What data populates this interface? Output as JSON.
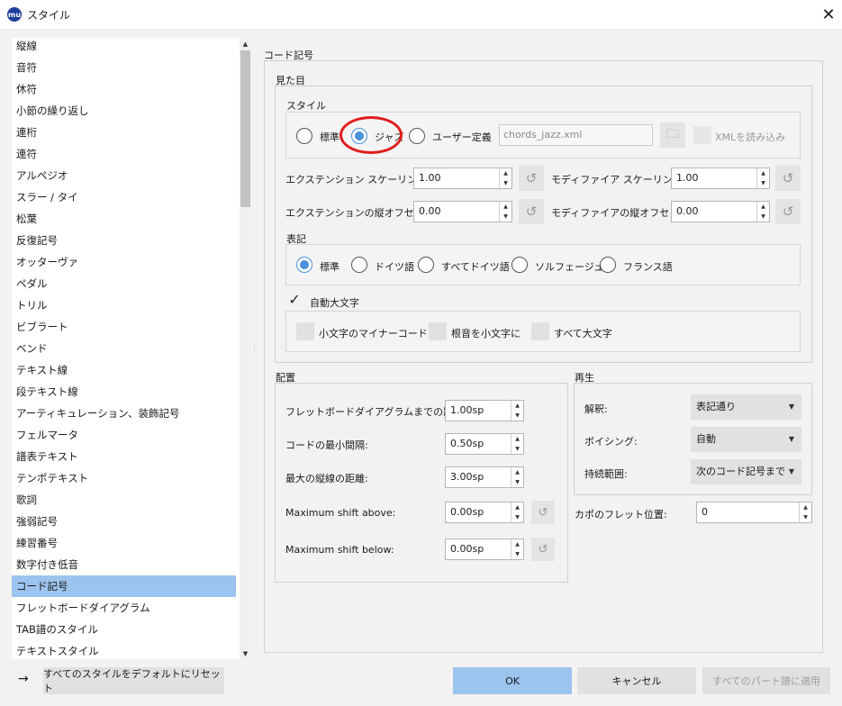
{
  "window": {
    "app_icon_text": "mu",
    "title": "スタイル",
    "close_icon": "close-icon"
  },
  "sidebar": {
    "items": [
      "縦線",
      "音符",
      "休符",
      "小節の繰り返し",
      "連桁",
      "連符",
      "アルペジオ",
      "スラー / タイ",
      "松葉",
      "反復記号",
      "オッターヴァ",
      "ペダル",
      "トリル",
      "ビブラート",
      "ベンド",
      "テキスト線",
      "段テキスト線",
      "アーティキュレーション、装飾記号",
      "フェルマータ",
      "譜表テキスト",
      "テンポテキスト",
      "歌詞",
      "強弱記号",
      "練習番号",
      "数字付き低音",
      "コード記号",
      "フレットボードダイアグラム",
      "TAB譜のスタイル",
      "テキストスタイル"
    ],
    "selected_index": 25
  },
  "page": {
    "title": "コード記号",
    "appearance": {
      "label": "見た目",
      "style_group": {
        "label": "スタイル",
        "options": [
          "標準",
          "ジャズ",
          "ユーザー定義"
        ],
        "selected": "ジャズ",
        "file_field_value": "chords_jazz.xml",
        "load_xml_label": "XMLを読み込み"
      },
      "extension_scaling": {
        "label": "エクステンション スケーリング:",
        "value": "1.00"
      },
      "modifier_scaling": {
        "label": "モディファイア スケーリング:",
        "value": "1.00"
      },
      "extension_offset": {
        "label": "エクステンションの縦オフセット:",
        "value": "0.00"
      },
      "modifier_offset": {
        "label": "モディファイアの縦オフセット:",
        "value": "0.00"
      },
      "notation": {
        "label": "表記",
        "options": [
          "標準",
          "ドイツ語",
          "すべてドイツ語",
          "ソルフェージュ",
          "フランス語"
        ],
        "selected": "標準"
      },
      "auto_capitalize": {
        "label": "自動大文字",
        "checked": true,
        "options": [
          "小文字のマイナーコード",
          "根音を小文字に",
          "すべて大文字"
        ]
      }
    },
    "placement": {
      "label": "配置",
      "rows": [
        {
          "label": "フレットボードダイアグラムまでの距離:",
          "value": "1.00sp"
        },
        {
          "label": "コードの最小間隔:",
          "value": "0.50sp"
        },
        {
          "label": "最大の縦線の距離:",
          "value": "3.00sp"
        },
        {
          "label": "Maximum shift above:",
          "value": "0.00sp"
        },
        {
          "label": "Maximum shift below:",
          "value": "0.00sp"
        }
      ]
    },
    "playback": {
      "label": "再生",
      "rows": [
        {
          "label": "解釈:",
          "value": "表記通り"
        },
        {
          "label": "ボイシング:",
          "value": "自動"
        },
        {
          "label": "持続範囲:",
          "value": "次のコード記号まで"
        }
      ]
    },
    "capo": {
      "label": "カポのフレット位置:",
      "value": "0"
    }
  },
  "footer": {
    "arrow_icon": "arrow-right-icon",
    "reset_all_label": "すべてのスタイルをデフォルトにリセット",
    "ok_label": "OK",
    "cancel_label": "キャンセル",
    "apply_all_label": "すべてのパート譜に適用"
  },
  "colors": {
    "selection": "#9dc4ee",
    "radio_checked": "#4a90d9",
    "annotation_circle": "#e01c1c"
  }
}
